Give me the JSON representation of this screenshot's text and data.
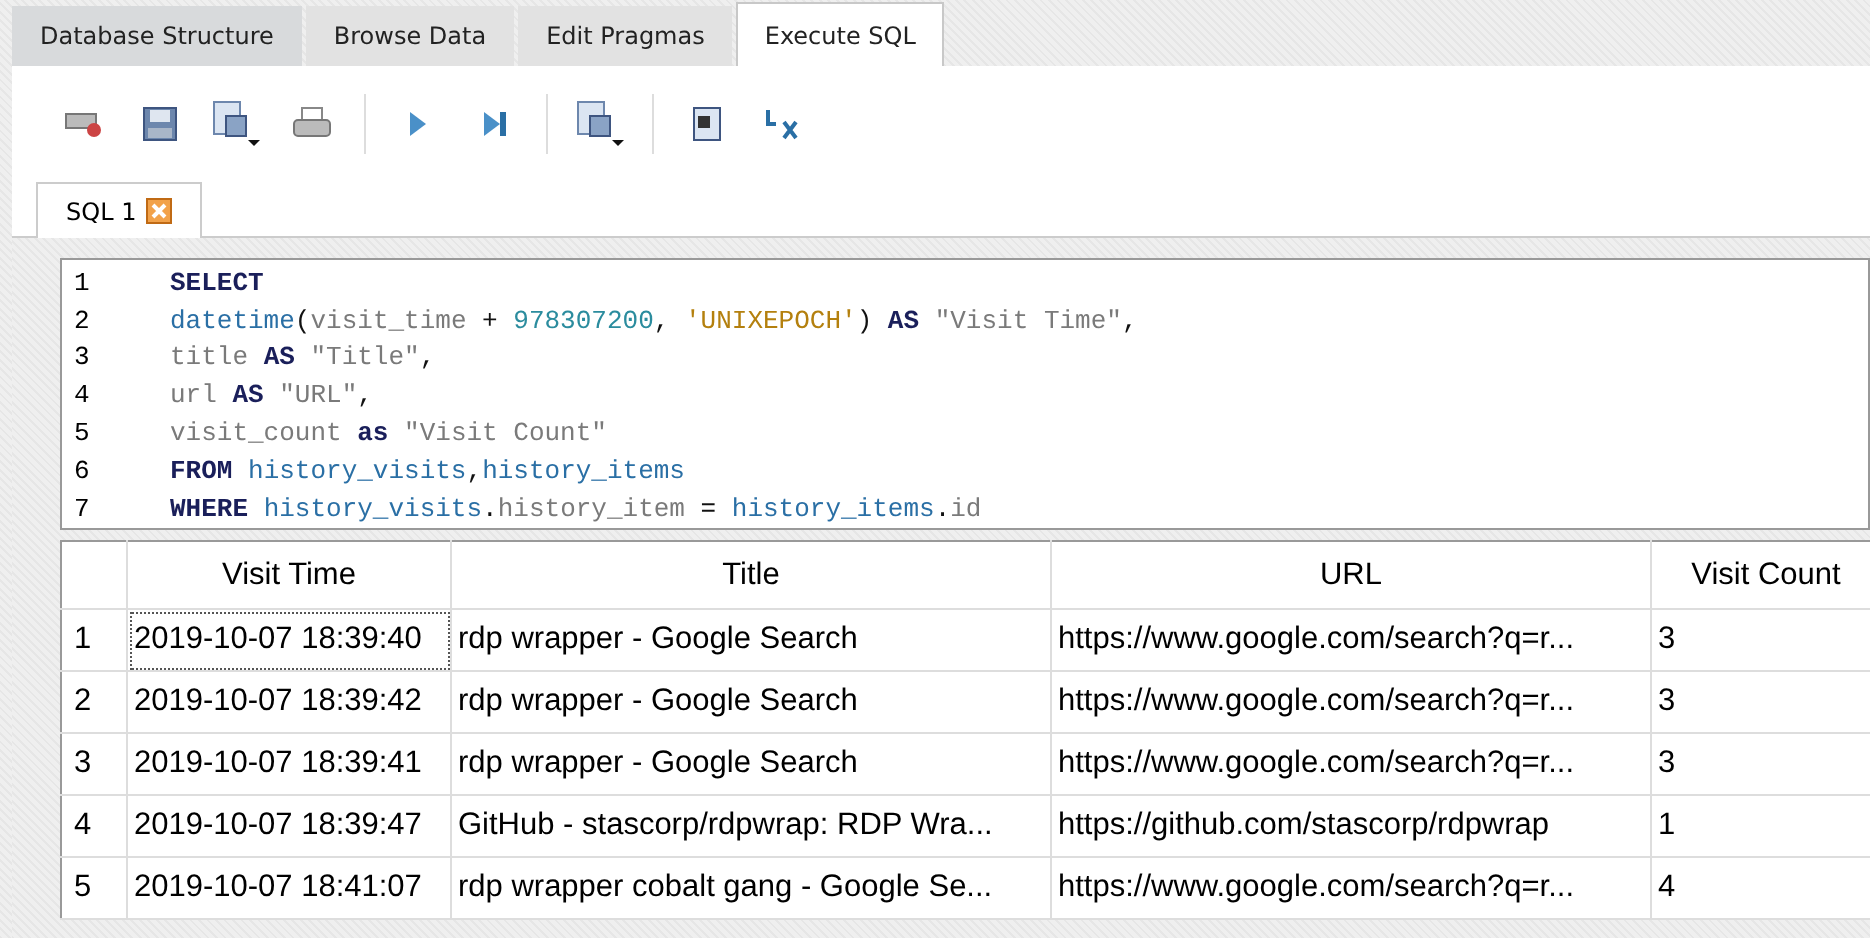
{
  "tabs": [
    {
      "label": "Database Structure",
      "selected": false
    },
    {
      "label": "Browse Data",
      "selected": false
    },
    {
      "label": "Edit Pragmas",
      "selected": false
    },
    {
      "label": "Execute SQL",
      "selected": true
    }
  ],
  "editor_tabs": [
    {
      "label": "SQL 1",
      "selected": true
    }
  ],
  "editor": {
    "lines": [
      {
        "number": "1",
        "tokens": [
          {
            "text": "SELECT",
            "kind": "keyword"
          }
        ]
      },
      {
        "number": "2",
        "tokens": [
          {
            "text": "datetime",
            "kind": "function"
          },
          {
            "text": "(",
            "kind": "plain"
          },
          {
            "text": "visit_time",
            "kind": "ident"
          },
          {
            "text": " + ",
            "kind": "plain"
          },
          {
            "text": "978307200",
            "kind": "number"
          },
          {
            "text": ", ",
            "kind": "plain"
          },
          {
            "text": "'UNIXEPOCH'",
            "kind": "string"
          },
          {
            "text": ") ",
            "kind": "plain"
          },
          {
            "text": "AS",
            "kind": "keyword"
          },
          {
            "text": " \"Visit Time\"",
            "kind": "ident"
          },
          {
            "text": ",",
            "kind": "plain"
          }
        ]
      },
      {
        "number": "3",
        "tokens": [
          {
            "text": "title",
            "kind": "ident"
          },
          {
            "text": " AS",
            "kind": "keyword"
          },
          {
            "text": " \"Title\"",
            "kind": "ident"
          },
          {
            "text": ",",
            "kind": "plain"
          }
        ]
      },
      {
        "number": "4",
        "tokens": [
          {
            "text": "url",
            "kind": "ident"
          },
          {
            "text": " AS",
            "kind": "keyword"
          },
          {
            "text": " \"URL\"",
            "kind": "ident"
          },
          {
            "text": ",",
            "kind": "plain"
          }
        ]
      },
      {
        "number": "5",
        "tokens": [
          {
            "text": "visit_count",
            "kind": "ident"
          },
          {
            "text": " as",
            "kind": "keyword"
          },
          {
            "text": " \"Visit Count\"",
            "kind": "ident"
          }
        ]
      },
      {
        "number": "6",
        "tokens": [
          {
            "text": "FROM",
            "kind": "keyword"
          },
          {
            "text": " history_visits",
            "kind": "function"
          },
          {
            "text": ",",
            "kind": "plain"
          },
          {
            "text": "history_items",
            "kind": "function"
          }
        ]
      },
      {
        "number": "7",
        "tokens": [
          {
            "text": "WHERE",
            "kind": "keyword"
          },
          {
            "text": " history_visits",
            "kind": "function"
          },
          {
            "text": ".",
            "kind": "plain"
          },
          {
            "text": "history_item",
            "kind": "ident"
          },
          {
            "text": " = ",
            "kind": "plain"
          },
          {
            "text": "history_items",
            "kind": "function"
          },
          {
            "text": ".",
            "kind": "plain"
          },
          {
            "text": "id",
            "kind": "ident"
          }
        ]
      }
    ]
  },
  "results": {
    "columns": [
      "Visit Time",
      "Title",
      "URL",
      "Visit Count"
    ],
    "rows": [
      {
        "number": "1",
        "cells": [
          "2019-10-07 18:39:40",
          "rdp wrapper - Google Search",
          "https://www.google.com/search?q=r...",
          "3"
        ]
      },
      {
        "number": "2",
        "cells": [
          "2019-10-07 18:39:42",
          "rdp wrapper - Google Search",
          "https://www.google.com/search?q=r...",
          "3"
        ]
      },
      {
        "number": "3",
        "cells": [
          "2019-10-07 18:39:41",
          "rdp wrapper - Google Search",
          "https://www.google.com/search?q=r...",
          "3"
        ]
      },
      {
        "number": "4",
        "cells": [
          "2019-10-07 18:39:47",
          "GitHub - stascorp/rdpwrap: RDP Wra...",
          "https://github.com/stascorp/rdpwrap",
          "1"
        ]
      },
      {
        "number": "5",
        "cells": [
          "2019-10-07 18:41:07",
          "rdp wrapper cobalt gang - Google Se...",
          "https://www.google.com/search?q=r...",
          "4"
        ]
      }
    ]
  }
}
